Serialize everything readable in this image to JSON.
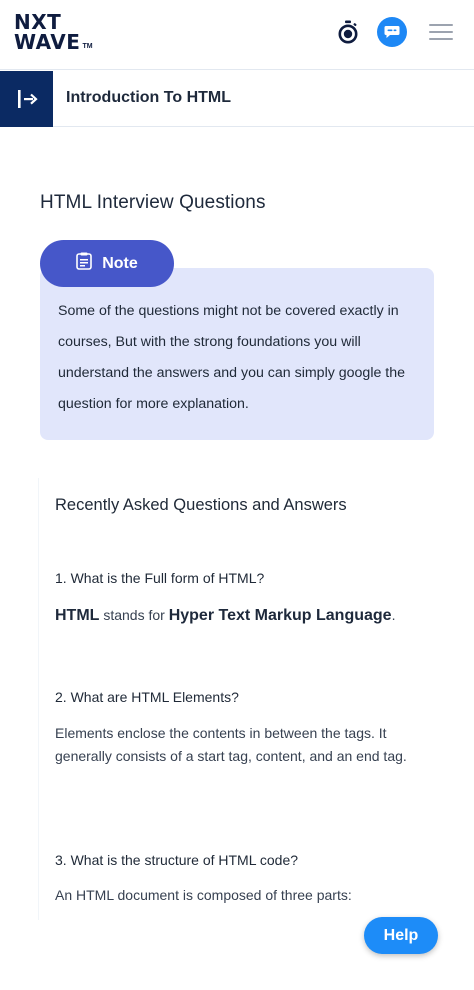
{
  "header": {
    "logo_line1": "NXT",
    "logo_line2": "WAVE",
    "logo_tm": "TM"
  },
  "course": {
    "title": "Introduction To HTML"
  },
  "page": {
    "heading": "HTML Interview Questions"
  },
  "note": {
    "label": "Note",
    "text": "Some of the questions might not be covered exactly in courses, But with the strong foundations you will understand the answers and you can simply google the question for more explanation."
  },
  "qa": {
    "title": "Recently Asked Questions and Answers",
    "items": [
      {
        "question": "1. What is the Full form of HTML?",
        "answer_parts": [
          "HTML",
          " stands for ",
          "Hyper Text Markup Language",
          "."
        ]
      },
      {
        "question": "2. What are HTML Elements?",
        "answer": "Elements enclose the contents in between the tags. It generally consists of a start tag, content, and an end tag."
      },
      {
        "question": "3. What is the structure of HTML code?",
        "answer": "An HTML document is composed of three parts:"
      }
    ]
  },
  "help": {
    "label": "Help"
  },
  "icons": {
    "timer": "stopwatch-icon",
    "chat": "chat-bubble-icon",
    "menu": "hamburger-menu-icon",
    "sidebar_toggle": "sidebar-toggle-icon",
    "note": "notepad-icon"
  },
  "colors": {
    "brand_navy": "#0b2a63",
    "note_pill": "#4657c9",
    "note_bg": "#e1e6fb",
    "help_blue": "#1d8cf8"
  }
}
